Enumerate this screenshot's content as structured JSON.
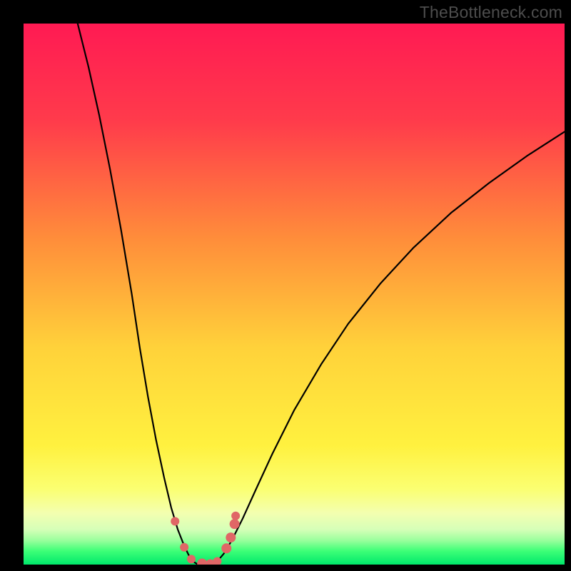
{
  "watermark": "TheBottleneck.com",
  "chart_data": {
    "type": "line",
    "title": "",
    "xlabel": "",
    "ylabel": "",
    "xlim": [
      0,
      100
    ],
    "ylim": [
      0,
      100
    ],
    "gradient_stops": [
      {
        "offset": 0.0,
        "color": "#ff1a53"
      },
      {
        "offset": 0.18,
        "color": "#ff3b4b"
      },
      {
        "offset": 0.4,
        "color": "#ff8e3a"
      },
      {
        "offset": 0.6,
        "color": "#ffd23a"
      },
      {
        "offset": 0.78,
        "color": "#fff13f"
      },
      {
        "offset": 0.86,
        "color": "#fbff71"
      },
      {
        "offset": 0.905,
        "color": "#f3ffb0"
      },
      {
        "offset": 0.935,
        "color": "#d6ffb8"
      },
      {
        "offset": 0.955,
        "color": "#9bff9d"
      },
      {
        "offset": 0.975,
        "color": "#3dff77"
      },
      {
        "offset": 1.0,
        "color": "#00e86b"
      }
    ],
    "series": [
      {
        "name": "left-branch",
        "x": [
          10.0,
          12.0,
          14.0,
          16.0,
          18.0,
          20.0,
          21.5,
          23.0,
          24.5,
          26.0,
          27.3,
          28.5,
          29.6,
          30.5,
          31.3
        ],
        "y": [
          100.0,
          92.0,
          83.0,
          73.0,
          62.0,
          50.0,
          40.0,
          31.0,
          23.0,
          16.0,
          10.5,
          6.5,
          3.7,
          1.8,
          0.6
        ]
      },
      {
        "name": "valley-floor",
        "x": [
          31.3,
          32.0,
          33.0,
          34.0,
          35.0,
          35.8
        ],
        "y": [
          0.6,
          0.15,
          0.05,
          0.05,
          0.15,
          0.6
        ]
      },
      {
        "name": "right-branch",
        "x": [
          35.8,
          37.0,
          38.5,
          40.5,
          43.0,
          46.0,
          50.0,
          55.0,
          60.0,
          66.0,
          72.0,
          79.0,
          86.0,
          93.0,
          100.0
        ],
        "y": [
          0.6,
          2.0,
          4.5,
          8.5,
          14.0,
          20.5,
          28.5,
          37.0,
          44.5,
          52.0,
          58.5,
          65.0,
          70.5,
          75.5,
          80.0
        ]
      }
    ],
    "markers": [
      {
        "x": 28.0,
        "y": 8.0,
        "r": 6
      },
      {
        "x": 29.7,
        "y": 3.2,
        "r": 6
      },
      {
        "x": 31.0,
        "y": 1.0,
        "r": 6
      },
      {
        "x": 33.0,
        "y": 0.2,
        "r": 7
      },
      {
        "x": 34.5,
        "y": 0.2,
        "r": 6
      },
      {
        "x": 35.8,
        "y": 0.6,
        "r": 6
      },
      {
        "x": 37.5,
        "y": 3.0,
        "r": 7
      },
      {
        "x": 38.3,
        "y": 5.0,
        "r": 7
      },
      {
        "x": 39.0,
        "y": 7.5,
        "r": 7
      },
      {
        "x": 39.2,
        "y": 9.0,
        "r": 6
      }
    ],
    "marker_color": "#e06666"
  }
}
